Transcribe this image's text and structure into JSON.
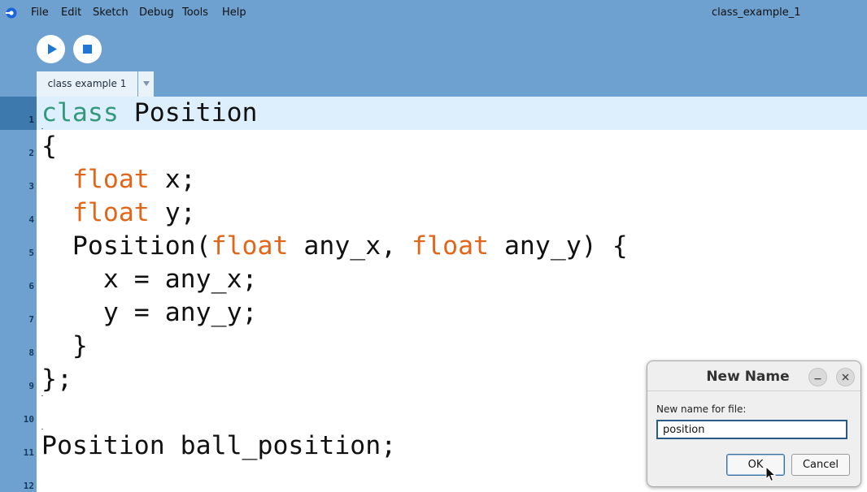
{
  "window": {
    "title": "class_example_1"
  },
  "menu": {
    "items": [
      "File",
      "Edit",
      "Sketch",
      "Debug",
      "Tools",
      "Help"
    ]
  },
  "toolbar": {
    "run_icon": "play-icon",
    "stop_icon": "stop-icon"
  },
  "tabs": [
    {
      "label": "class example 1",
      "active": true
    }
  ],
  "editor": {
    "current_line": 1,
    "line_numbers": [
      "1",
      "2",
      "3",
      "4",
      "5",
      "6",
      "7",
      "8",
      "9",
      "10",
      "11",
      "12"
    ],
    "lines": [
      [
        {
          "t": "class",
          "k": "kw-class"
        },
        {
          "t": " Position",
          "k": ""
        }
      ],
      [
        {
          "t": "{",
          "k": ""
        }
      ],
      [
        {
          "t": "  ",
          "k": ""
        },
        {
          "t": "float",
          "k": "kw-type"
        },
        {
          "t": " x;",
          "k": ""
        }
      ],
      [
        {
          "t": "  ",
          "k": ""
        },
        {
          "t": "float",
          "k": "kw-type"
        },
        {
          "t": " y;",
          "k": ""
        }
      ],
      [
        {
          "t": "  Position(",
          "k": ""
        },
        {
          "t": "float",
          "k": "kw-type"
        },
        {
          "t": " any_x, ",
          "k": ""
        },
        {
          "t": "float",
          "k": "kw-type"
        },
        {
          "t": " any_y) {",
          "k": ""
        }
      ],
      [
        {
          "t": "    x = any_x;",
          "k": ""
        }
      ],
      [
        {
          "t": "    y = any_y;",
          "k": ""
        }
      ],
      [
        {
          "t": "  }",
          "k": ""
        }
      ],
      [
        {
          "t": "};",
          "k": ""
        }
      ],
      [
        {
          "t": "",
          "k": ""
        }
      ],
      [
        {
          "t": "Position ball_position;",
          "k": ""
        }
      ],
      [
        {
          "t": "",
          "k": ""
        }
      ]
    ]
  },
  "dialog": {
    "title": "New Name",
    "label": "New name for file:",
    "input_value": "position",
    "ok_label": "OK",
    "cancel_label": "Cancel",
    "minimize_icon": "minimize-icon",
    "close_icon": "close-icon"
  },
  "colors": {
    "toolbar_bg": "#6ea0d0",
    "current_line_bg": "#ddeefc",
    "keyword_class": "#33997e",
    "keyword_type": "#e2661a"
  }
}
